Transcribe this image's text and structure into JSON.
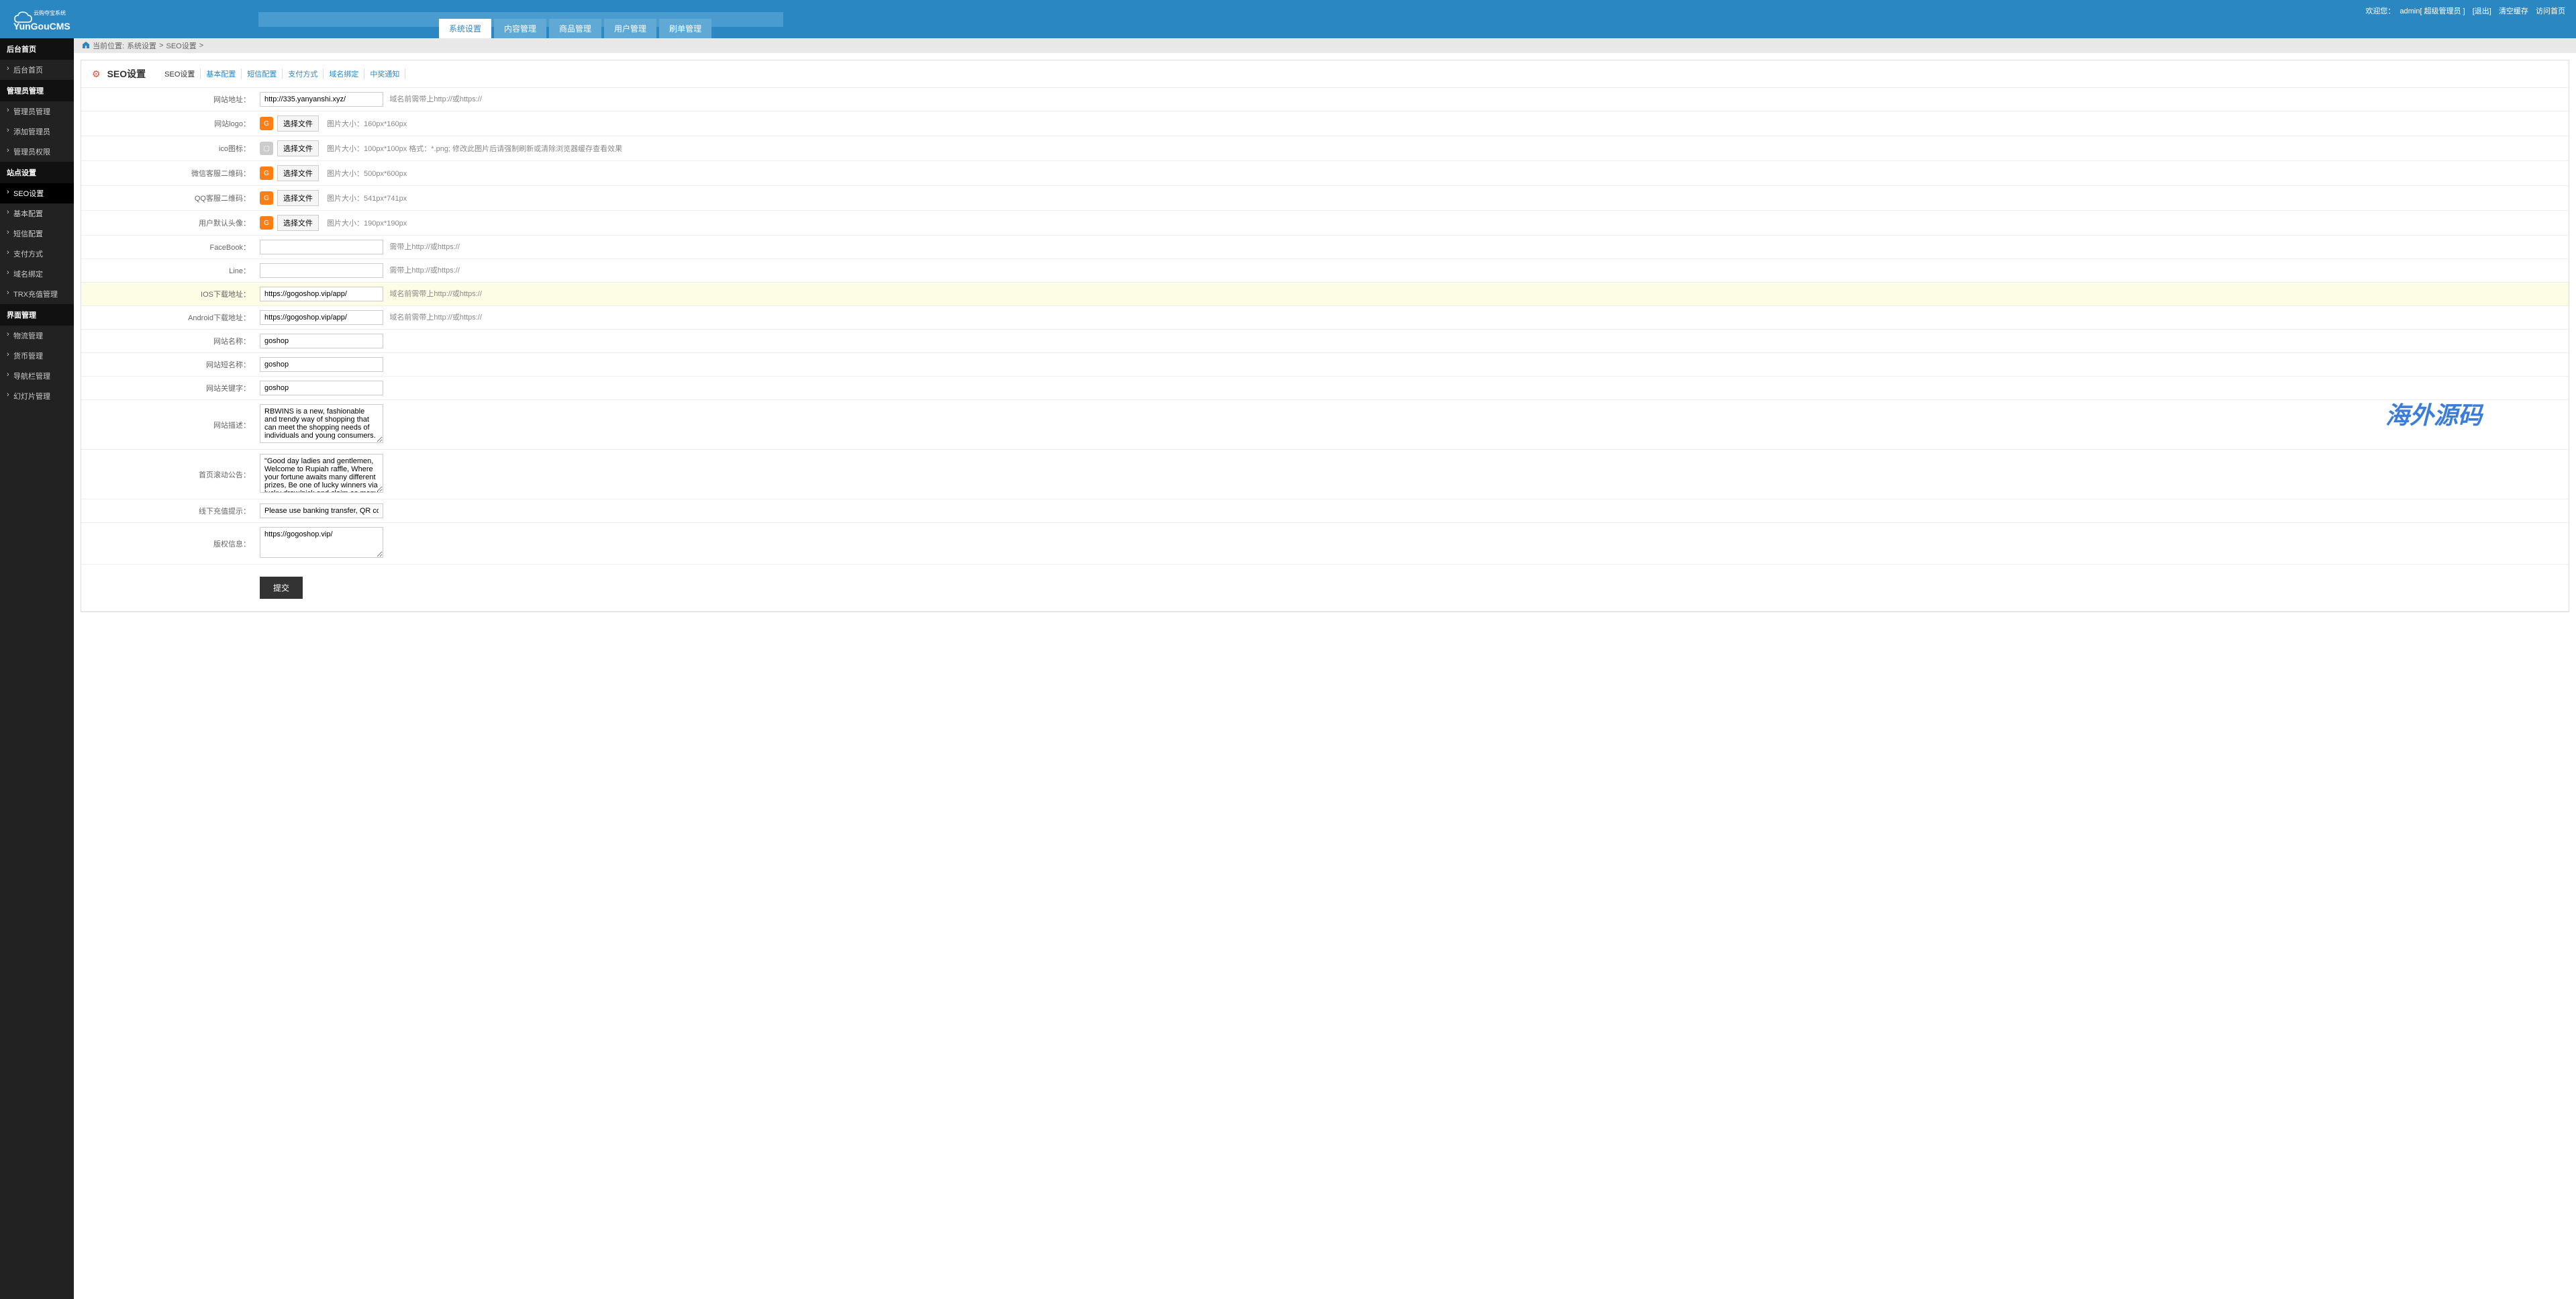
{
  "header": {
    "logo_main": "YunGouCMS",
    "logo_sub": "云购夺宝系统",
    "welcome": "欢迎您：",
    "admin_role": "admin[ 超级管理员 ]",
    "logout": "[退出]",
    "clear_cache": "清空缓存",
    "visit_home": "访问首页"
  },
  "nav_tabs": [
    {
      "label": "系统设置",
      "active": true
    },
    {
      "label": "内容管理",
      "active": false
    },
    {
      "label": "商品管理",
      "active": false
    },
    {
      "label": "用户管理",
      "active": false
    },
    {
      "label": "刷单管理",
      "active": false
    }
  ],
  "sidebar": [
    {
      "type": "header",
      "label": "后台首页"
    },
    {
      "type": "item",
      "label": "后台首页"
    },
    {
      "type": "header",
      "label": "管理员管理"
    },
    {
      "type": "item",
      "label": "管理员管理"
    },
    {
      "type": "item",
      "label": "添加管理员"
    },
    {
      "type": "item",
      "label": "管理员权限"
    },
    {
      "type": "header",
      "label": "站点设置"
    },
    {
      "type": "item",
      "label": "SEO设置",
      "active": true
    },
    {
      "type": "item",
      "label": "基本配置"
    },
    {
      "type": "item",
      "label": "短信配置"
    },
    {
      "type": "item",
      "label": "支付方式"
    },
    {
      "type": "item",
      "label": "域名绑定"
    },
    {
      "type": "item",
      "label": "TRX充值管理"
    },
    {
      "type": "header",
      "label": "界面管理"
    },
    {
      "type": "item",
      "label": "物流管理"
    },
    {
      "type": "item",
      "label": "货币管理"
    },
    {
      "type": "item",
      "label": "导航栏管理"
    },
    {
      "type": "item",
      "label": "幻灯片管理"
    }
  ],
  "breadcrumb": {
    "prefix": "当前位置:",
    "items": [
      "系统设置",
      "SEO设置"
    ]
  },
  "page": {
    "title": "SEO设置",
    "tabs": [
      "SEO设置",
      "基本配置",
      "短信配置",
      "支付方式",
      "域名绑定",
      "中奖通知"
    ]
  },
  "form": {
    "site_url_label": "网站地址：",
    "site_url": "http://335.yanyanshi.xyz/",
    "site_url_hint": "域名前需带上http://或https://",
    "logo_label": "网站logo：",
    "file_btn": "选择文件",
    "logo_hint": "图片大小：160px*160px",
    "ico_label": "ico图标：",
    "ico_hint": "图片大小：100px*100px  格式：*.png; 修改此图片后请强制刷新或清除浏览器缓存查看效果",
    "wx_qr_label": "微信客服二维码：",
    "wx_qr_hint": "图片大小：500px*600px",
    "qq_qr_label": "QQ客服二维码：",
    "qq_qr_hint": "图片大小：541px*741px",
    "avatar_label": "用户默认头像：",
    "avatar_hint": "图片大小：190px*190px",
    "facebook_label": "FaceBook：",
    "facebook": "",
    "fb_hint": "需带上http://或https://",
    "line_label": "Line：",
    "line": "",
    "line_hint": "需带上http://或https://",
    "ios_label": "IOS下载地址：",
    "ios_url": "https://gogoshop.vip/app/",
    "ios_hint": "域名前需带上http://或https://",
    "android_label": "Android下载地址：",
    "android_url": "https://gogoshop.vip/app/",
    "android_hint": "域名前需带上http://或https://",
    "site_name_label": "网站名称：",
    "site_name": "goshop",
    "site_short_label": "网站短名称：",
    "site_short": "goshop",
    "keywords_label": "网站关键字：",
    "keywords": "goshop",
    "desc_label": "网站描述：",
    "desc": "RBWINS is a new, fashionable and trendy way of shopping that can meet the shopping needs of individuals and young consumers.",
    "scroll_label": "首页滚动公告：",
    "scroll": "\"Good day ladies and gentlemen, Welcome to Rupiah raffle, Where your fortune awaits many different prizes, Be one of lucky winners via lucky draw/pick and claim as many prizes, and many more. May you have a great and wonderful day a",
    "recharge_label": "线下充值提示：",
    "recharge": "Please use banking transfer, QR code to recharge",
    "copyright_label": "版权信息：",
    "copyright": "https://gogoshop.vip/",
    "submit": "提交"
  },
  "watermark": "海外源码"
}
